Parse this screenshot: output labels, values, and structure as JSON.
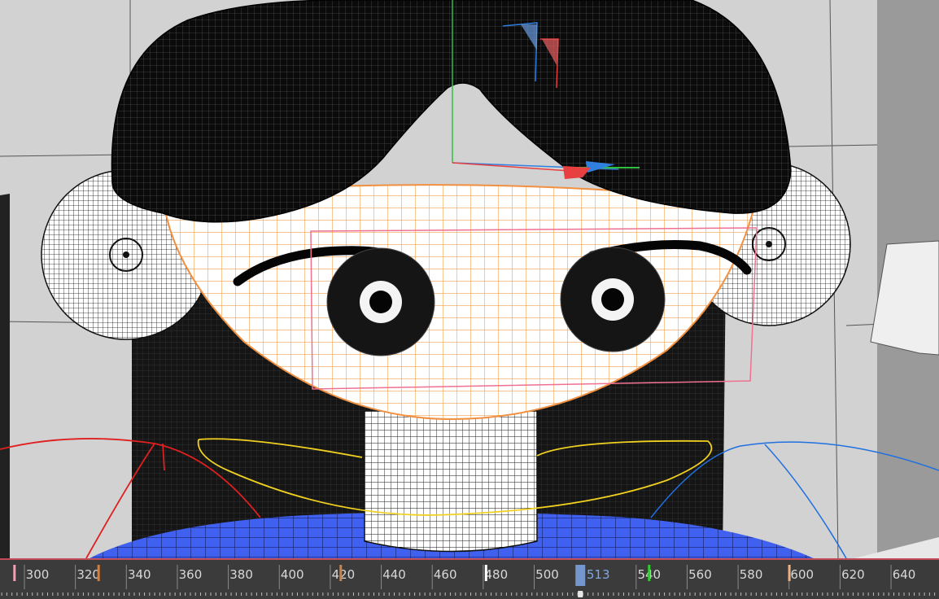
{
  "viewport": {
    "mode": "wireframe-on-shaded",
    "colors": {
      "background": "#cfcfcf",
      "hair": "#0b0b0b",
      "face_wire": "#f0a050",
      "selection_box": "#f07090",
      "shirt": "#4060f0",
      "curve_red": "#e02020",
      "curve_yellow": "#f0d020",
      "curve_blue": "#2070e0"
    }
  },
  "gizmo": {
    "icons": [
      "move-gizmo-icon",
      "rotate-handle-icon"
    ],
    "axis_colors": {
      "x": "#e84040",
      "y": "#30c040",
      "z": "#3080e0"
    }
  },
  "timeline": {
    "ticks": [
      {
        "frame": 300,
        "label": "300"
      },
      {
        "frame": 320,
        "label": "320"
      },
      {
        "frame": 340,
        "label": "340"
      },
      {
        "frame": 360,
        "label": "360"
      },
      {
        "frame": 380,
        "label": "380"
      },
      {
        "frame": 400,
        "label": "400"
      },
      {
        "frame": 420,
        "label": "420"
      },
      {
        "frame": 440,
        "label": "440"
      },
      {
        "frame": 460,
        "label": "460"
      },
      {
        "frame": 480,
        "label": "480"
      },
      {
        "frame": 500,
        "label": "500"
      },
      {
        "frame": 540,
        "label": "540"
      },
      {
        "frame": 560,
        "label": "560"
      },
      {
        "frame": 580,
        "label": "580"
      },
      {
        "frame": 600,
        "label": "600"
      },
      {
        "frame": 620,
        "label": "620"
      },
      {
        "frame": 640,
        "label": "640"
      }
    ],
    "current_frame": 513,
    "current_label": "513",
    "key_markers": [
      {
        "frame": 291,
        "color": "#f0a0b0"
      },
      {
        "frame": 324,
        "color": "#d08040"
      },
      {
        "frame": 419,
        "color": "#d08040"
      },
      {
        "frame": 476,
        "color": "#ffffff"
      },
      {
        "frame": 540,
        "color": "#30d030"
      },
      {
        "frame": 595,
        "color": "#f0b080"
      }
    ],
    "colors": {
      "background": "#3b3b3b",
      "text": "#d8d8d8",
      "current": "#7fa7e6",
      "range_bar": "#c04a56"
    }
  }
}
